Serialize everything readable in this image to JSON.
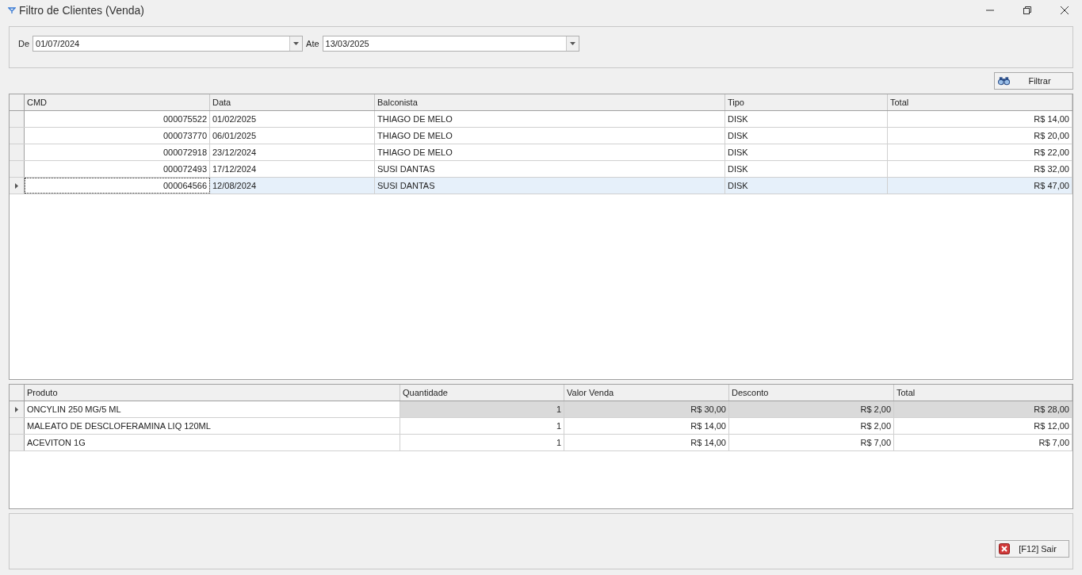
{
  "window": {
    "title": "Filtro de Clientes (Venda)"
  },
  "filter": {
    "from_label": "De",
    "from_value": "01/07/2024",
    "to_label": "Ate",
    "to_value": "13/03/2025"
  },
  "filter_button": {
    "label": "Filtrar"
  },
  "orders": {
    "columns": [
      "CMD",
      "Data",
      "Balconista",
      "Tipo",
      "Total"
    ],
    "rows": [
      {
        "cells": [
          "000075522",
          "01/02/2025",
          "THIAGO DE MELO",
          "DISK",
          "R$ 14,00"
        ],
        "selected": false
      },
      {
        "cells": [
          "000073770",
          "06/01/2025",
          "THIAGO DE MELO",
          "DISK",
          "R$ 20,00"
        ],
        "selected": false
      },
      {
        "cells": [
          "000072918",
          "23/12/2024",
          "THIAGO DE MELO",
          "DISK",
          "R$ 22,00"
        ],
        "selected": false
      },
      {
        "cells": [
          "000072493",
          "17/12/2024",
          "SUSI DANTAS",
          "DISK",
          "R$ 32,00"
        ],
        "selected": false
      },
      {
        "cells": [
          "000064566",
          "12/08/2024",
          "SUSI DANTAS",
          "DISK",
          "R$ 47,00"
        ],
        "selected": true
      }
    ]
  },
  "items": {
    "columns": [
      "Produto",
      "Quantidade",
      "Valor Venda",
      "Desconto",
      "Total"
    ],
    "rows": [
      {
        "cells": [
          "ONCYLIN 250 MG/5 ML",
          "1",
          "R$ 30,00",
          "R$ 2,00",
          "R$ 28,00"
        ],
        "selected": true
      },
      {
        "cells": [
          "MALEATO DE DESCLOFERAMINA LIQ 120ML",
          "1",
          "R$ 14,00",
          "R$ 2,00",
          "R$ 12,00"
        ],
        "selected": false
      },
      {
        "cells": [
          "ACEVITON 1G",
          "1",
          "R$ 14,00",
          "R$ 7,00",
          "R$ 7,00"
        ],
        "selected": false
      }
    ]
  },
  "exit_button": {
    "label": "[F12] Sair"
  }
}
